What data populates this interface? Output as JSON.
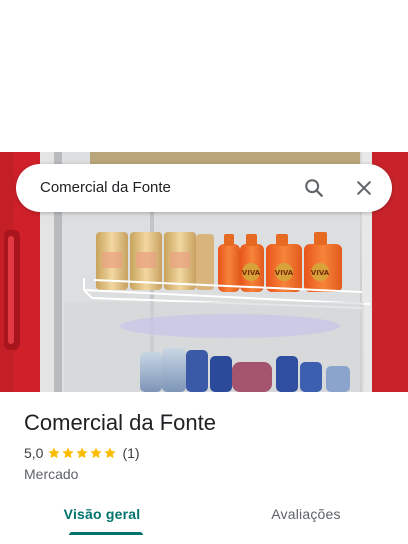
{
  "search": {
    "query": "Comercial da Fonte"
  },
  "place": {
    "name": "Comercial da Fonte",
    "rating": "5,0",
    "rating_stars": 5,
    "review_count": "(1)",
    "category": "Mercado"
  },
  "photo": {
    "bottle_label": "VIVA"
  },
  "tabs": [
    {
      "label": "Visão geral",
      "selected": true
    },
    {
      "label": "Avaliações",
      "selected": false
    }
  ],
  "icons": {
    "search": "search-icon",
    "close": "close-icon",
    "star": "star-icon"
  },
  "colors": {
    "accent": "#00736d",
    "star": "#fbbc04",
    "fridge_red": "#d0202a"
  }
}
